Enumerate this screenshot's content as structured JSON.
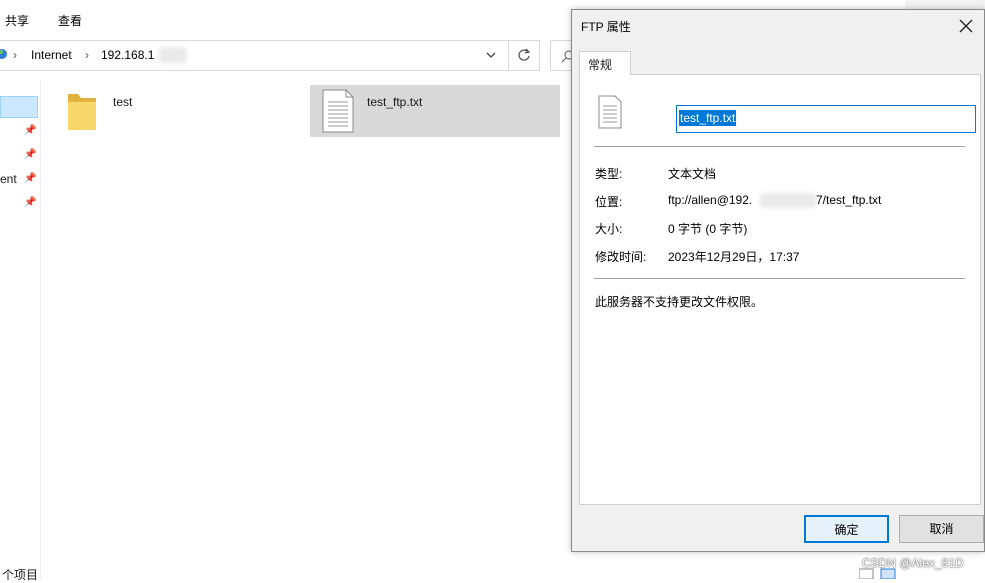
{
  "explorer": {
    "ribbon_tabs": [
      "共享",
      "查看"
    ],
    "address": {
      "segment_1": "Internet",
      "segment_2": "192.168.1"
    },
    "nav_partial_label": "ent",
    "items": [
      {
        "name": "test",
        "type": "folder"
      },
      {
        "name": "test_ftp.txt",
        "type": "file"
      }
    ],
    "status_partial": "个项目"
  },
  "dialog": {
    "title": "FTP 属性",
    "close_glyph": "✕",
    "tab_label": "常规",
    "filename_value": "test_ftp.txt",
    "labels": {
      "type": "类型:",
      "location": "位置:",
      "size": "大小:",
      "modified": "修改时间:"
    },
    "values": {
      "type": "文本文档",
      "location_prefix": "ftp://allen@192.",
      "location_suffix": "7/test_ftp.txt",
      "size": "0 字节 (0 字节)",
      "modified": "2023年12月29日，17:37"
    },
    "note": "此服务器不支持更改文件权限。",
    "ok_label": "确定",
    "cancel_label": "取消"
  },
  "watermark": "CSDN @Alex_81D",
  "colors": {
    "accent": "#0078d7",
    "selection_bg": "#d9d9d9",
    "folder": "#f4c851"
  }
}
